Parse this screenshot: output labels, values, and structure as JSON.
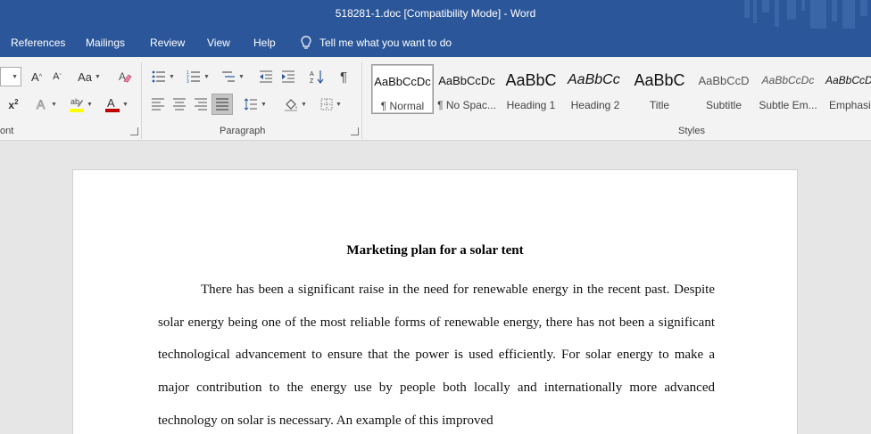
{
  "window": {
    "title": "518281-1.doc [Compatibility Mode]  -  Word"
  },
  "menu": {
    "items": [
      "References",
      "Mailings",
      "Review",
      "View",
      "Help"
    ],
    "tell_me": "Tell me what you want to do"
  },
  "ribbon": {
    "font_group_label": "ont",
    "paragraph_group_label": "Paragraph",
    "styles_group_label": "Styles",
    "grow_font": "A",
    "shrink_font": "A",
    "change_case": "Aa",
    "superscript": "x",
    "font_color_letter": "A",
    "font_color": "#c00000",
    "highlight_color": "#ffff00",
    "styles": [
      {
        "preview": "AaBbCcDc",
        "name": "¶ Normal",
        "selected": true
      },
      {
        "preview": "AaBbCcDc",
        "name": "¶ No Spac..."
      },
      {
        "preview": "AaBbC",
        "name": "Heading 1"
      },
      {
        "preview": "AaBbCc",
        "name": "Heading 2"
      },
      {
        "preview": "AaBbC",
        "name": "Title"
      },
      {
        "preview": "AaBbCcD",
        "name": "Subtitle"
      },
      {
        "preview": "AaBbCcDc",
        "name": "Subtle Em..."
      },
      {
        "preview": "AaBbCcD",
        "name": "Emphasis"
      }
    ]
  },
  "document": {
    "title": "Marketing plan for a solar tent",
    "body": "There has been a significant raise in the need for renewable energy in the recent past. Despite solar energy being one of the most reliable forms of renewable energy, there has not been a significant technological advancement to ensure that the power is used efficiently. For solar energy to make a major contribution to the energy use by people both locally and internationally more advanced technology on solar is necessary. An example of this improved"
  }
}
